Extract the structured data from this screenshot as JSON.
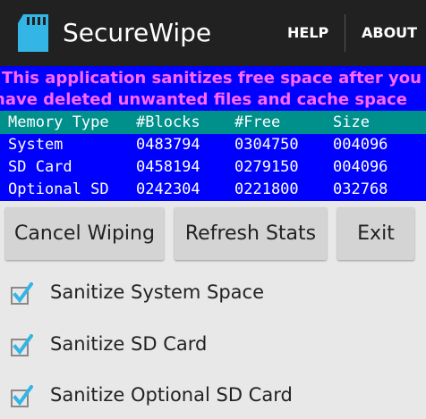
{
  "app": {
    "title": "SecureWipe"
  },
  "actionbar": {
    "help_label": "HELP",
    "about_label": "ABOUT"
  },
  "info": {
    "line1": "This application sanitizes free space after you",
    "line2": "have deleted unwanted files and cache space"
  },
  "memory_table": {
    "headers": [
      "Memory Type",
      "#Blocks",
      "#Free",
      "Size"
    ],
    "rows": [
      [
        "System",
        "0483794",
        "0304750",
        "004096"
      ],
      [
        "SD Card",
        "0458194",
        "0279150",
        "004096"
      ],
      [
        "Optional SD",
        "0242304",
        "0221800",
        "032768"
      ]
    ]
  },
  "buttons": {
    "cancel_label": "Cancel Wiping",
    "refresh_label": "Refresh Stats",
    "exit_label": "Exit"
  },
  "options": [
    {
      "label": "Sanitize System Space",
      "checked": true
    },
    {
      "label": "Sanitize SD Card",
      "checked": true
    },
    {
      "label": "Sanitize Optional SD Card",
      "checked": true
    }
  ],
  "colors": {
    "actionbar_bg": "#212121",
    "info_bg": "#0000ff",
    "info_text": "#ff66ff",
    "table_header_bg": "#00908c",
    "table_bg": "#0000ff",
    "check_accent": "#33b5e5",
    "app_icon": "#33b5e5"
  },
  "icons": {
    "app_icon": "sd-card-icon",
    "checkbox": "checkmark-icon"
  }
}
